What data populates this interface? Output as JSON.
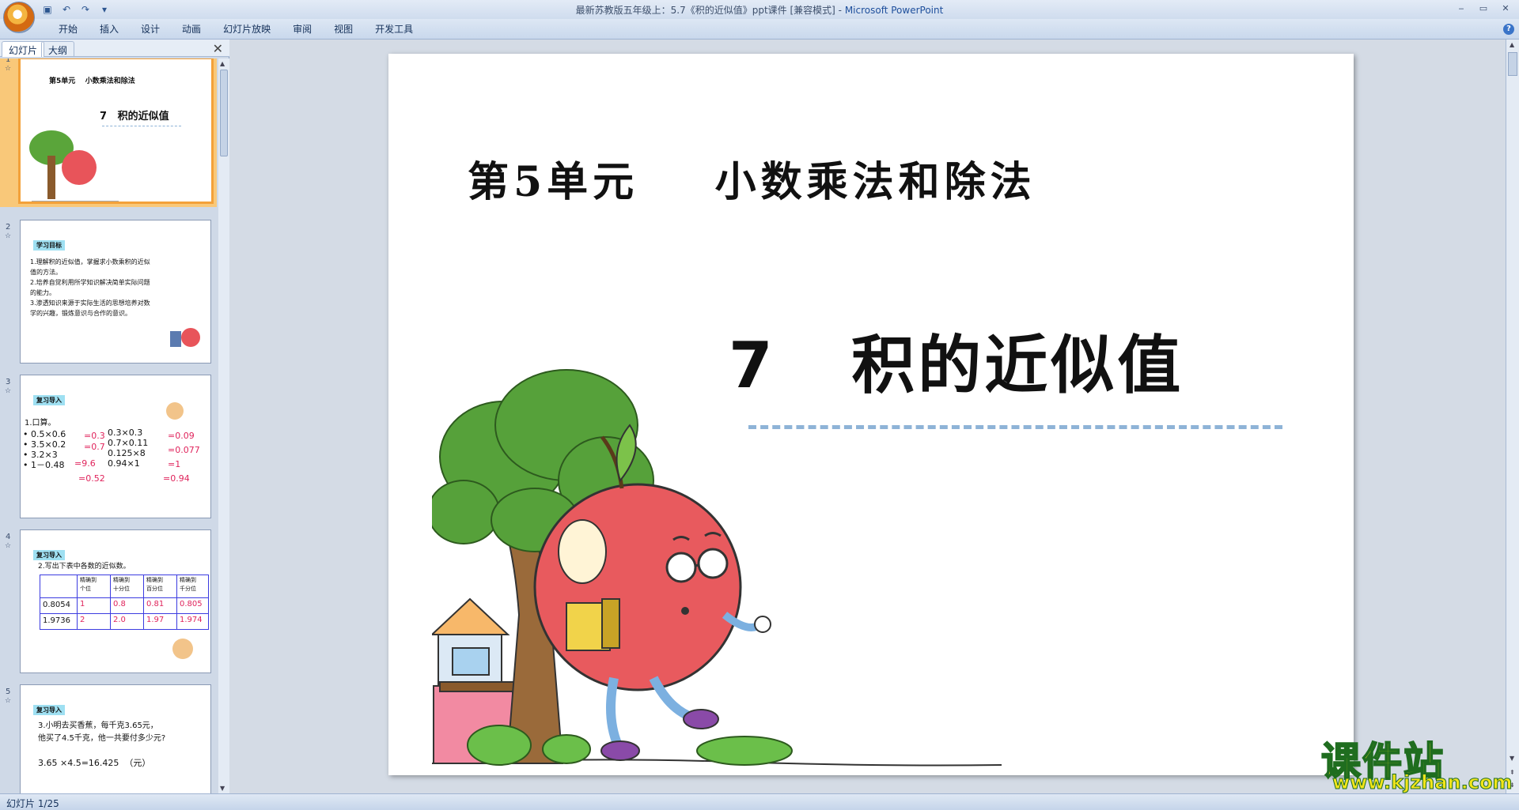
{
  "window": {
    "title_doc": "最新苏教版五年级上：5.7《积的近似值》ppt课件 [兼容模式] - ",
    "title_app": "Microsoft PowerPoint",
    "controls": [
      "‒",
      "▭",
      "✕"
    ]
  },
  "ribbon": {
    "tabs": [
      "开始",
      "插入",
      "设计",
      "动画",
      "幻灯片放映",
      "审阅",
      "视图",
      "开发工具"
    ]
  },
  "panel": {
    "tab_slides": "幻灯片",
    "tab_outline": "大纲",
    "close": "✕"
  },
  "thumbnails": [
    {
      "num": "1",
      "unit": "第5单元    小数乘法和除法",
      "title": "7   积的近似值"
    },
    {
      "num": "2",
      "badge": "学习目标",
      "lines": "1.理解积的近似值，掌握求小数乘积的近似\n值的方法。\n2.培养自觉利用所学知识解决简单实际问题\n的能力。\n3.渗透知识来源于实际生活的思想培养对数\n学的兴趣，锻炼意识与合作的意识。"
    },
    {
      "num": "3",
      "badge": "复习导入",
      "heading": "1.口算。",
      "left": "• 0.5×0.6\n• 3.5×0.2\n• 3.2×3\n• 1－0.48",
      "mid": "0.3×0.3\n0.7×0.11\n0.125×8\n0.94×1",
      "answers": [
        "=0.3",
        "=0.7",
        "=9.6",
        "=0.52",
        "=0.09",
        "=0.077",
        "=1",
        "=0.94"
      ]
    },
    {
      "num": "4",
      "badge": "复习导入",
      "heading": "2.写出下表中各数的近似数。",
      "headers": [
        "精确到\n个位",
        "精确到\n十分位",
        "精确到\n百分位",
        "精确到\n千分位"
      ],
      "rows": [
        {
          "label": "0.8054",
          "vals": [
            "1",
            "0.8",
            "0.81",
            "0.805"
          ]
        },
        {
          "label": "1.9736",
          "vals": [
            "2",
            "2.0",
            "1.97",
            "1.974"
          ]
        }
      ]
    },
    {
      "num": "5",
      "badge": "复习导入",
      "lines": "3.小明去买香蕉，每千克3.65元，\n他买了4.5千克，他一共要付多少元?",
      "formula": "3.65 ×4.5=16.425  （元）"
    }
  ],
  "slide": {
    "unit_title": "第5单元    小数乘法和除法",
    "lesson_title": "7   积的近似值"
  },
  "watermark": {
    "text_cn": "课件站",
    "url": "www.kjzhan.com"
  },
  "status": {
    "text": "幻灯片 1/25"
  }
}
